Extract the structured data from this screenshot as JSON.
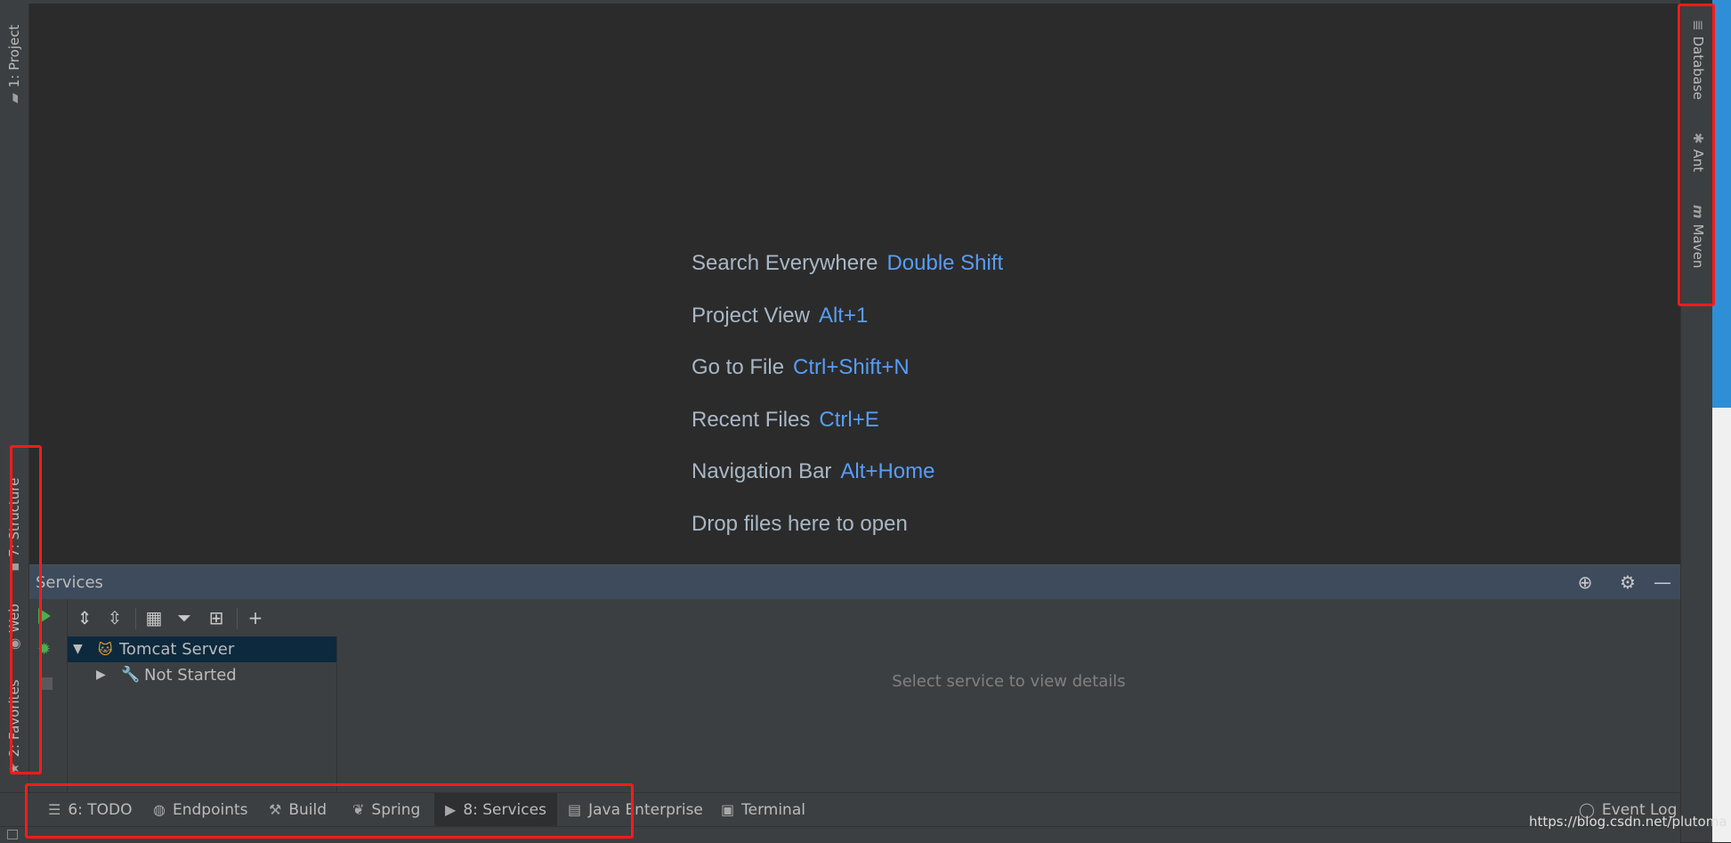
{
  "left_stripe": {
    "project_label": "1: Project",
    "structure_label": "7: Structure",
    "web_label": "Web",
    "favorites_label": "2: Favorites"
  },
  "right_stripe": {
    "database_label": "Database",
    "ant_label": "Ant",
    "maven_label": "Maven"
  },
  "editor": {
    "hints": [
      {
        "label": "Search Everywhere",
        "key": "Double Shift"
      },
      {
        "label": "Project View",
        "key": "Alt+1"
      },
      {
        "label": "Go to File",
        "key": "Ctrl+Shift+N"
      },
      {
        "label": "Recent Files",
        "key": "Ctrl+E"
      },
      {
        "label": "Navigation Bar",
        "key": "Alt+Home"
      }
    ],
    "drop_text": "Drop files here to open"
  },
  "services": {
    "title": "Services",
    "tree": {
      "server": "Tomcat Server",
      "status": "Not Started"
    },
    "detail_placeholder": "Select service to view details"
  },
  "bottom_tabs": {
    "todo": "6: TODO",
    "endpoints": "Endpoints",
    "build": "Build",
    "spring": "Spring",
    "services": "8: Services",
    "java_enterprise": "Java Enterprise",
    "terminal": "Terminal",
    "event_log": "Event Log"
  },
  "watermark": "https://blog.csdn.net/plutoma",
  "colors": {
    "editor_bg": "#2b2b2b",
    "panel_bg": "#3c3f41",
    "header_bg": "#3d4b5c",
    "shortcut_blue": "#589df6",
    "highlight_red": "#ff1a1a",
    "selection_bg": "#0d293e"
  }
}
